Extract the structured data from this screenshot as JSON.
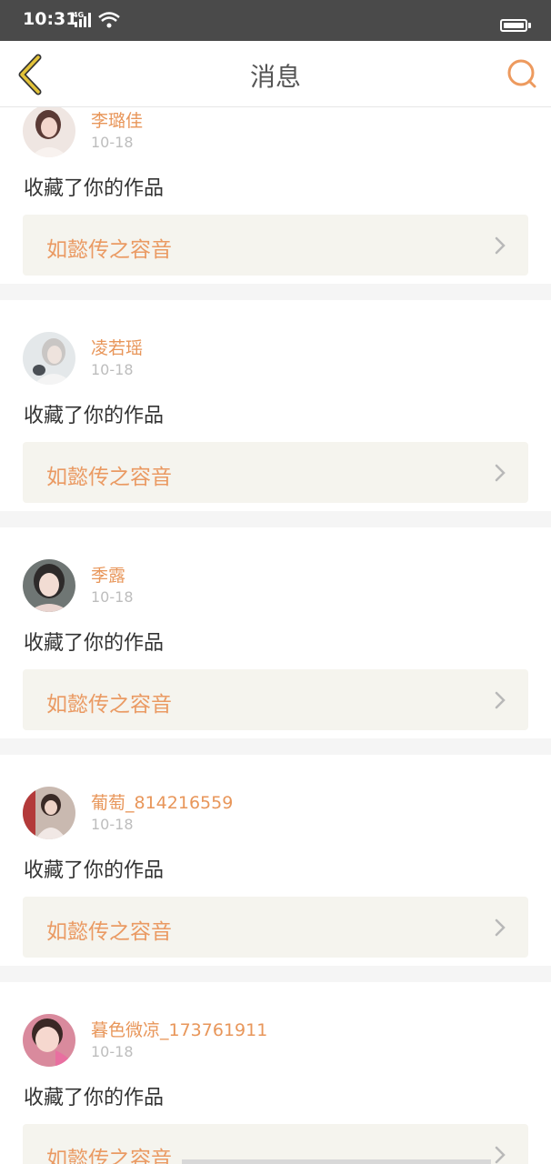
{
  "status": {
    "time": "10:31",
    "network": "4G"
  },
  "header": {
    "title": "消息"
  },
  "colors": {
    "accent": "#e8965a",
    "back_arrow": "#c7a322",
    "work_bg": "#f5f4ee"
  },
  "messages": [
    {
      "name": "李璐佳",
      "date": "10-18",
      "action": "收藏了你的作品",
      "work": "如懿传之容音"
    },
    {
      "name": "凌若瑶",
      "date": "10-18",
      "action": "收藏了你的作品",
      "work": "如懿传之容音"
    },
    {
      "name": "季露",
      "date": "10-18",
      "action": "收藏了你的作品",
      "work": "如懿传之容音"
    },
    {
      "name": "葡萄_814216559",
      "date": "10-18",
      "action": "收藏了你的作品",
      "work": "如懿传之容音"
    },
    {
      "name": "暮色微凉_173761911",
      "date": "10-18",
      "action": "收藏了你的作品",
      "work": "如懿传之容音"
    }
  ],
  "icons": {
    "back": "chevron-left-icon",
    "search": "search-icon",
    "arrow": "chevron-right-icon"
  }
}
